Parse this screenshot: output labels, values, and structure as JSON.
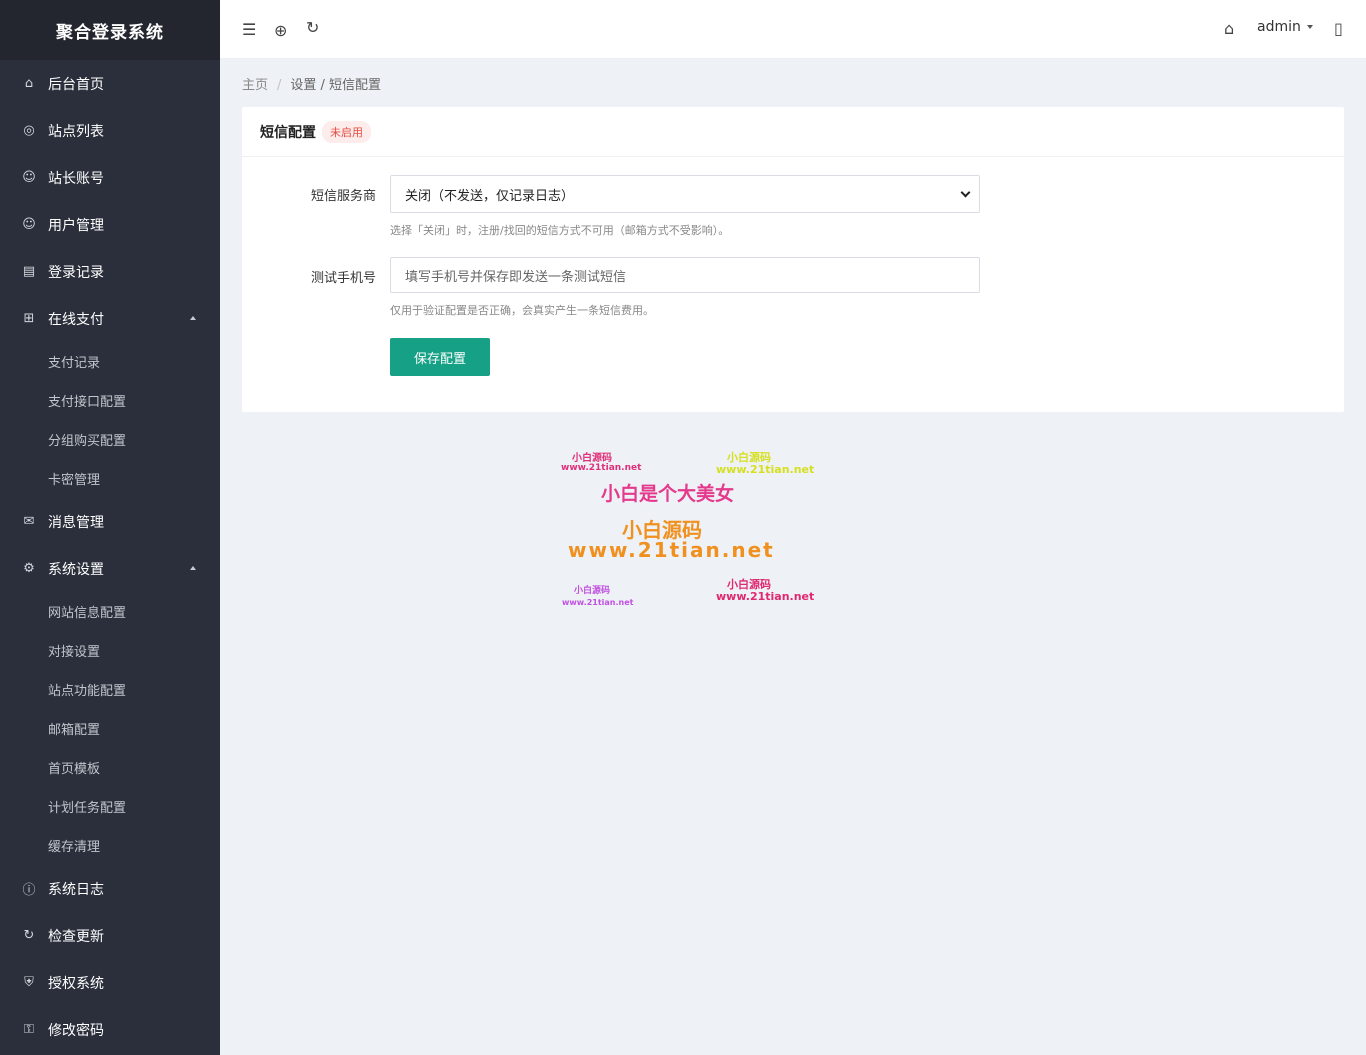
{
  "sidebar": {
    "title": "聚合登录系统",
    "items": [
      {
        "label": "后台首页",
        "icon": "⌂"
      },
      {
        "label": "站点列表",
        "icon": "◎"
      },
      {
        "label": "站长账号",
        "icon": "☺"
      },
      {
        "label": "用户管理",
        "icon": "☺"
      },
      {
        "label": "登录记录",
        "icon": "▤"
      },
      {
        "label": "在线支付",
        "icon": "⊞"
      },
      {
        "label": "消息管理",
        "icon": "✉"
      },
      {
        "label": "系统设置",
        "icon": "⚙"
      },
      {
        "label": "系统日志",
        "icon": "ⓘ"
      },
      {
        "label": "检查更新",
        "icon": "↻"
      },
      {
        "label": "授权系统",
        "icon": "⛨"
      },
      {
        "label": "修改密码",
        "icon": "⚿"
      }
    ],
    "payment_sub": [
      "支付记录",
      "支付接口配置",
      "分组购买配置",
      "卡密管理"
    ],
    "settings_sub": [
      "网站信息配置",
      "对接设置",
      "站点功能配置",
      "邮箱配置",
      "首页模板",
      "计划任务配置",
      "缓存清理"
    ]
  },
  "header": {
    "menu_icon": "☰",
    "globe_icon": "⊕",
    "refresh_icon": "↻",
    "home_icon": "⌂",
    "user": "admin",
    "fullscreen_icon": "▯"
  },
  "breadcrumb": {
    "home": "主页",
    "sep": "/",
    "current": "设置 / 短信配置"
  },
  "card": {
    "title": "短信配置",
    "badge": "未启用",
    "provider_label": "短信服务商",
    "provider_value": "关闭（不发送，仅记录日志）",
    "provider_hint": "选择「关闭」时，注册/找回的短信方式不可用（邮箱方式不受影响）。",
    "phone_label": "测试手机号",
    "phone_placeholder": "填写手机号并保存即发送一条测试短信",
    "phone_hint": "仅用于验证配置是否正确，会真实产生一条短信费用。",
    "save_label": "保存配置"
  },
  "watermark": {
    "a1": "小白源码",
    "a2": "www.21tian.net",
    "b1": "小白源码",
    "b2": "www.21tian.net",
    "center": "小白是个大美女",
    "big1": "小白源码",
    "big2": "www.21tian.net",
    "c1": "小白源码",
    "c2": "www.21tian.net",
    "d1": "小白源码",
    "d2": "www.21tian.net"
  },
  "colors": {
    "sidebar_bg": "#2a2f3b",
    "logo_bg": "#23262e",
    "accent": "#16a085",
    "badge_text": "#e54d42"
  }
}
